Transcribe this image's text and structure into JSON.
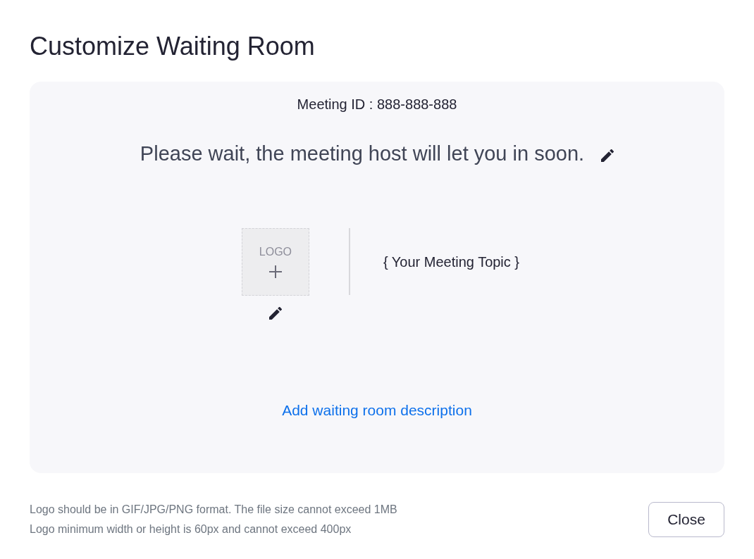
{
  "dialog": {
    "title": "Customize Waiting Room"
  },
  "preview": {
    "meeting_id": "Meeting ID : 888-888-888",
    "message": "Please wait, the meeting host will let you in soon.",
    "logo_upload": {
      "label": "LOGO"
    },
    "topic": "{ Your Meeting Topic }",
    "description_link": "Add waiting room description"
  },
  "notes": [
    "Logo should be in GIF/JPG/PNG format. The file size cannot exceed 1MB",
    "Logo minimum width or height is 60px and cannot exceed 400px"
  ],
  "buttons": [
    {
      "label": "Close"
    }
  ]
}
